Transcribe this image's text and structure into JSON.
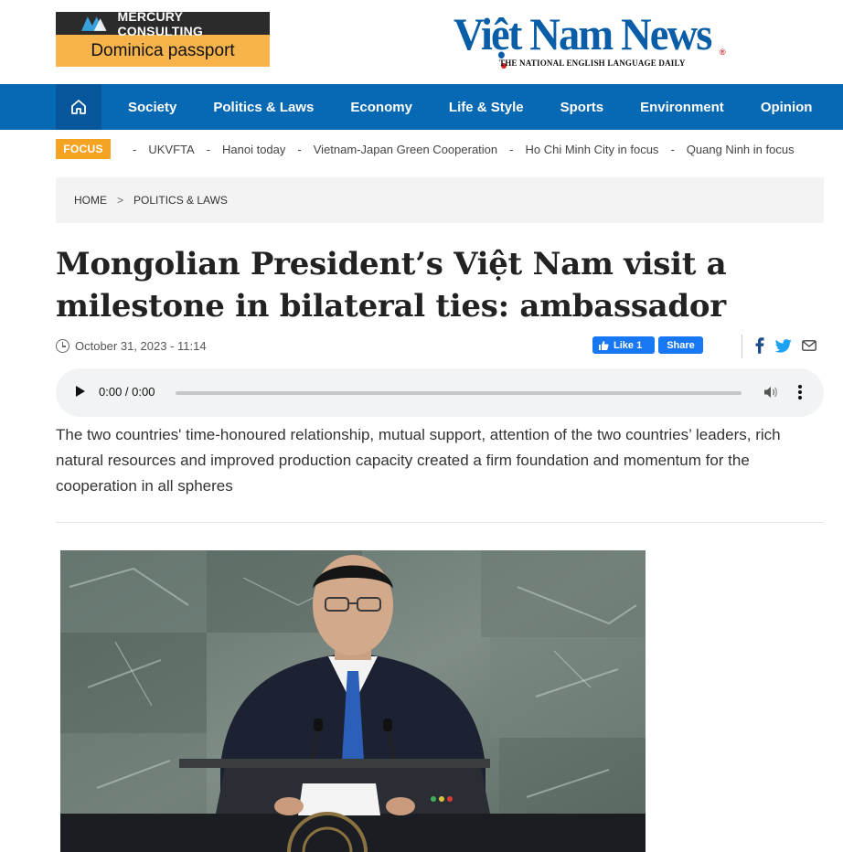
{
  "ad": {
    "brand": "MERCURY CONSULTING",
    "tagline": "Dominica passport",
    "colors": {
      "top": "#2b2b2b",
      "bottom": "#f6b44a",
      "logo": "#3aa0dc"
    }
  },
  "masthead": {
    "title": "Việt Nam News",
    "subtitle": "THE NATIONAL ENGLISH LANGUAGE DAILY",
    "trademark": "®"
  },
  "nav": {
    "home_icon": "home-icon",
    "items": [
      "Society",
      "Politics & Laws",
      "Economy",
      "Life & Style",
      "Sports",
      "Environment",
      "Opinion"
    ]
  },
  "focus": {
    "label": "FOCUS",
    "separator": "-",
    "items": [
      "UKVFTA",
      "Hanoi today",
      "Vietnam-Japan Green Cooperation",
      "Ho Chi Minh City in focus",
      "Quang Ninh in focus"
    ]
  },
  "breadcrumb": {
    "home": "HOME",
    "separator": ">",
    "section": "POLITICS & LAWS"
  },
  "article": {
    "headline": "Mongolian President’s Việt Nam visit a milestone in bilateral ties: ambassador",
    "date": "October 31, 2023 - 11:14",
    "summary": "The two countries' time-honoured relationship, mutual support, attention of the two countries’ leaders, rich natural resources and improved production capacity created a firm foundation and momentum for the cooperation in all spheres"
  },
  "social": {
    "like_label": "Like 1",
    "share_label": "Share",
    "icons": [
      "facebook-icon",
      "twitter-icon",
      "mail-icon"
    ]
  },
  "audio": {
    "time": "0:00 / 0:00",
    "progress": 0
  },
  "colors": {
    "brand_blue": "#0768b4",
    "focus_orange": "#f4a323",
    "facebook_blue": "#1877f2",
    "twitter_blue": "#1da1f2"
  }
}
